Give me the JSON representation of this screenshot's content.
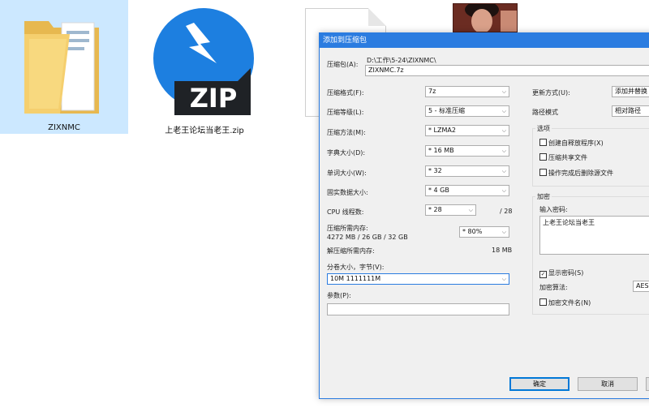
{
  "desktop": {
    "items": [
      {
        "label": "ZIXNMC",
        "icon": "folder-icon"
      },
      {
        "label": "上老王论坛当老王.zip",
        "icon": "zip-archive-icon",
        "zip_text": "ZIP"
      },
      {
        "label": "",
        "icon": "document-icon"
      },
      {
        "label": "",
        "icon": "image-thumbnail"
      }
    ]
  },
  "dialog": {
    "title": "添加到压缩包",
    "archive_label": "压缩包(A):",
    "archive_path": "D:\\工作\\5-24\\ZIXNMC\\",
    "archive_name": "ZIXNMC.7z",
    "format_label": "压缩格式(F):",
    "format_value": "7z",
    "level_label": "压缩等级(L):",
    "level_value": "5 - 标准压缩",
    "method_label": "压缩方法(M):",
    "method_value": "* LZMA2",
    "dict_label": "字典大小(D):",
    "dict_value": "* 16 MB",
    "word_label": "单词大小(W):",
    "word_value": "* 32",
    "solid_label": "固实数据大小:",
    "solid_value": "* 4 GB",
    "cpu_label": "CPU 线程数:",
    "cpu_value": "* 28",
    "cpu_total": "/ 28",
    "mem_label": "压缩所需内存:",
    "mem_detail": "4272 MB / 26 GB / 32 GB",
    "mem_value": "* 80%",
    "decomp_label": "解压缩所需内存:",
    "decomp_value": "18 MB",
    "split_label": "分卷大小，字节(V):",
    "split_value": "10M 1111111M",
    "params_label": "参数(P):",
    "params_value": "",
    "update_label": "更新方式(U):",
    "update_value": "添加并替换",
    "path_label": "路径模式",
    "path_value": "相对路径",
    "options_title": "选项",
    "opt_sfx": "创建自释放程序(X)",
    "opt_shared": "压缩共享文件",
    "opt_delete": "操作完成后删除源文件",
    "encrypt_title": "加密",
    "password_label": "输入密码:",
    "password_value": "上老王论坛当老王",
    "show_password": "显示密码(S)",
    "show_password_checked": "✓",
    "encrypt_method_label": "加密算法:",
    "encrypt_method_value": "AES",
    "encrypt_names": "加密文件名(N)",
    "ok": "确定",
    "cancel": "取消"
  },
  "colors": {
    "accent": "#2b7ce0",
    "selection": "#cce8ff",
    "zip_blue": "#1d7fe0"
  }
}
